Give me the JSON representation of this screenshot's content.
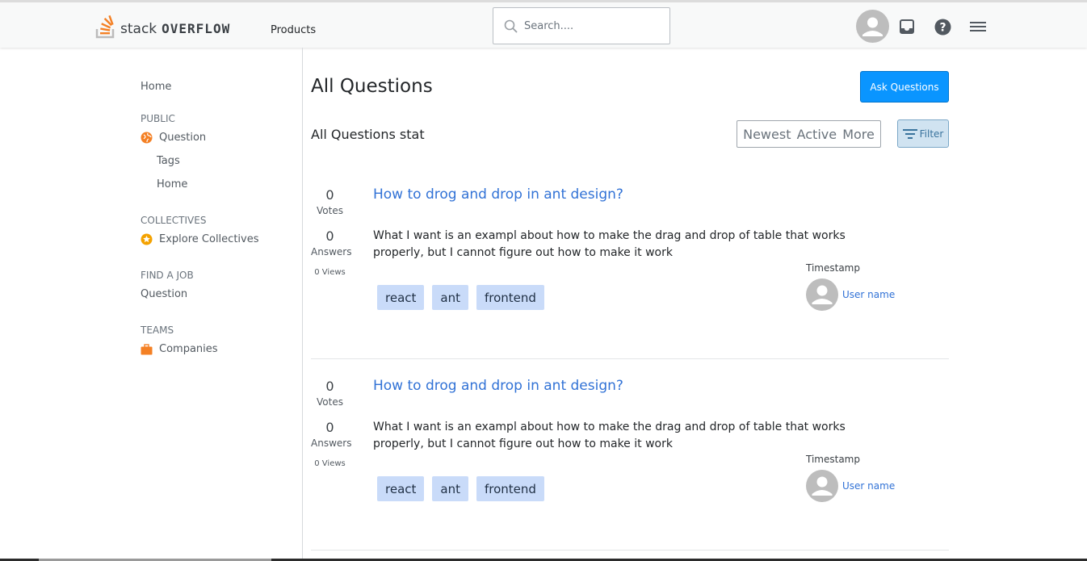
{
  "header": {
    "logo_stack": "stack",
    "logo_overflow": "OVERFLOW",
    "products_label": "Products",
    "search_placeholder": "Search....",
    "brand_color": "#f48024"
  },
  "sidebar": {
    "home": "Home",
    "public_heading": "PUBLIC",
    "question": "Question",
    "tags": "Tags",
    "home2": "Home",
    "collectives_heading": "COLLECTIVES",
    "explore_collectives": "Explore Collectives",
    "find_job_heading": "FIND A JOB",
    "job_question": "Question",
    "teams_heading": "TEAMS",
    "companies": "Companies"
  },
  "main": {
    "title": "All Questions",
    "ask_button": "Ask Questions",
    "stats_label": "All Questions stat",
    "sort_tabs": [
      "Newest",
      "Active",
      "More"
    ],
    "filter_label": "Filter",
    "questions": [
      {
        "votes": "0",
        "votes_label": "Votes",
        "answers": "0",
        "answers_label": "Answers",
        "views": "0 Views",
        "title": "How to drog and drop in ant design?",
        "excerpt_line1": "What I want is an exampl about how to make the drag and drop of table that works",
        "excerpt_line2": "properly, but I cannot figure out how to make it work",
        "tags": [
          "react",
          "ant",
          "frontend"
        ],
        "timestamp": "Timestamp",
        "user": "User name"
      },
      {
        "votes": "0",
        "votes_label": "Votes",
        "answers": "0",
        "answers_label": "Answers",
        "views": "0 Views",
        "title": "How to drog and drop in ant design?",
        "excerpt_line1": "What I want is an exampl about how to make the drag and drop of table that works",
        "excerpt_line2": "properly, but I cannot figure out how to make it work",
        "tags": [
          "react",
          "ant",
          "frontend"
        ],
        "timestamp": "Timestamp",
        "user": "User name"
      }
    ]
  }
}
